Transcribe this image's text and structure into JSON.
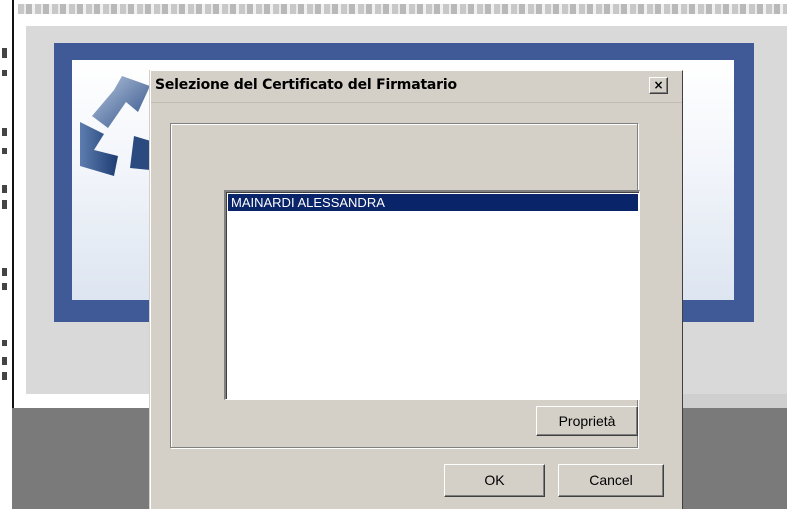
{
  "dialog": {
    "title": "Selezione del Certificato  del Firmatario",
    "close_symbol": "×",
    "certificates": [
      {
        "name": "MAINARDI ALESSANDRA",
        "selected": true
      }
    ],
    "properties_button": "Proprietà",
    "ok_button": "OK",
    "cancel_button": "Cancel"
  },
  "icons": {
    "close": "close-icon",
    "logo": "recycle-logo-icon"
  },
  "colors": {
    "dialog_face": "#d4d0c8",
    "selection": "#0a246a",
    "frame_blue": "#3f5a96"
  }
}
